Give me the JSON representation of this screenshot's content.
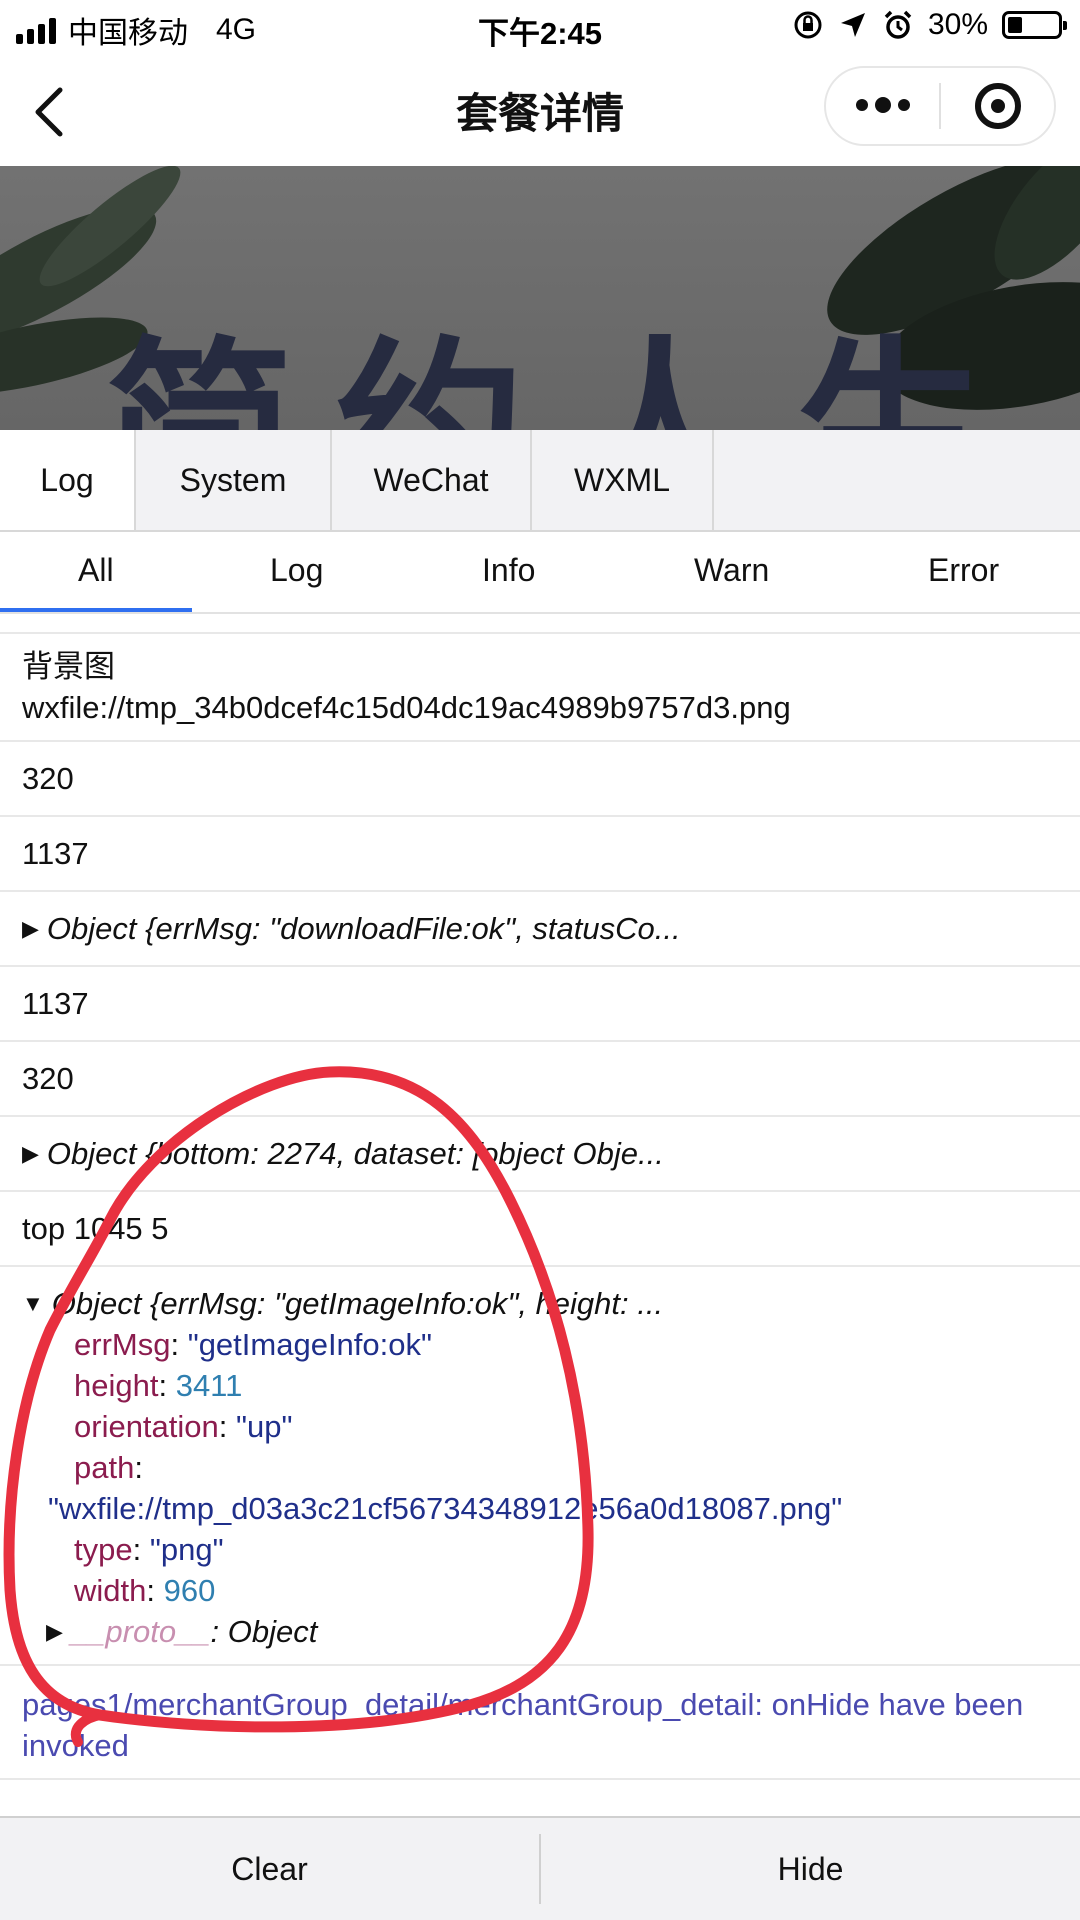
{
  "status_bar": {
    "carrier": "中国移动",
    "network": "4G",
    "time": "下午2:45",
    "battery": "30%",
    "battery_level": 0.3
  },
  "nav": {
    "title": "套餐详情"
  },
  "banner": {
    "text": "简约人生"
  },
  "console_tabs": [
    "Log",
    "System",
    "WeChat",
    "WXML"
  ],
  "filters": [
    "All",
    "Log",
    "Info",
    "Warn",
    "Error"
  ],
  "logs": {
    "bg_label": "背景图",
    "bg_path": "wxfile://tmp_34b0dcef4c15d04dc19ac4989b9757d3.png",
    "v1": "320",
    "v2": "1137",
    "obj1": "Object {errMsg: \"downloadFile:ok\", statusCo...",
    "v3": "1137",
    "v4": "320",
    "obj2": "Object {bottom: 2274, dataset: [object Obje...",
    "top_line": "top 1045 5",
    "obj3": "Object {errMsg: \"getImageInfo:ok\", height: ...",
    "props": {
      "errMsg_key": "errMsg",
      "errMsg_val": "\"getImageInfo:ok\"",
      "height_key": "height",
      "height_val": "3411",
      "orientation_key": "orientation",
      "orientation_val": "\"up\"",
      "path_key": "path",
      "path_val": "\"wxfile://tmp_d03a3c21cf56734348912e56a0d18087.png\"",
      "type_key": "type",
      "type_val": "\"png\"",
      "width_key": "width",
      "width_val": "960",
      "proto_key": "__proto__",
      "proto_val": ": Object"
    },
    "hide_msg": "pages1/merchantGroup_detail/merchantGroup_detail: onHide have been invoked"
  },
  "bottom": {
    "clear": "Clear",
    "hide": "Hide"
  },
  "colors": {
    "accent": "#2f6ff0",
    "annotation": "#e8303f",
    "key": "#8b1c4e",
    "string": "#1f2f8a",
    "number": "#2f7fb0"
  }
}
